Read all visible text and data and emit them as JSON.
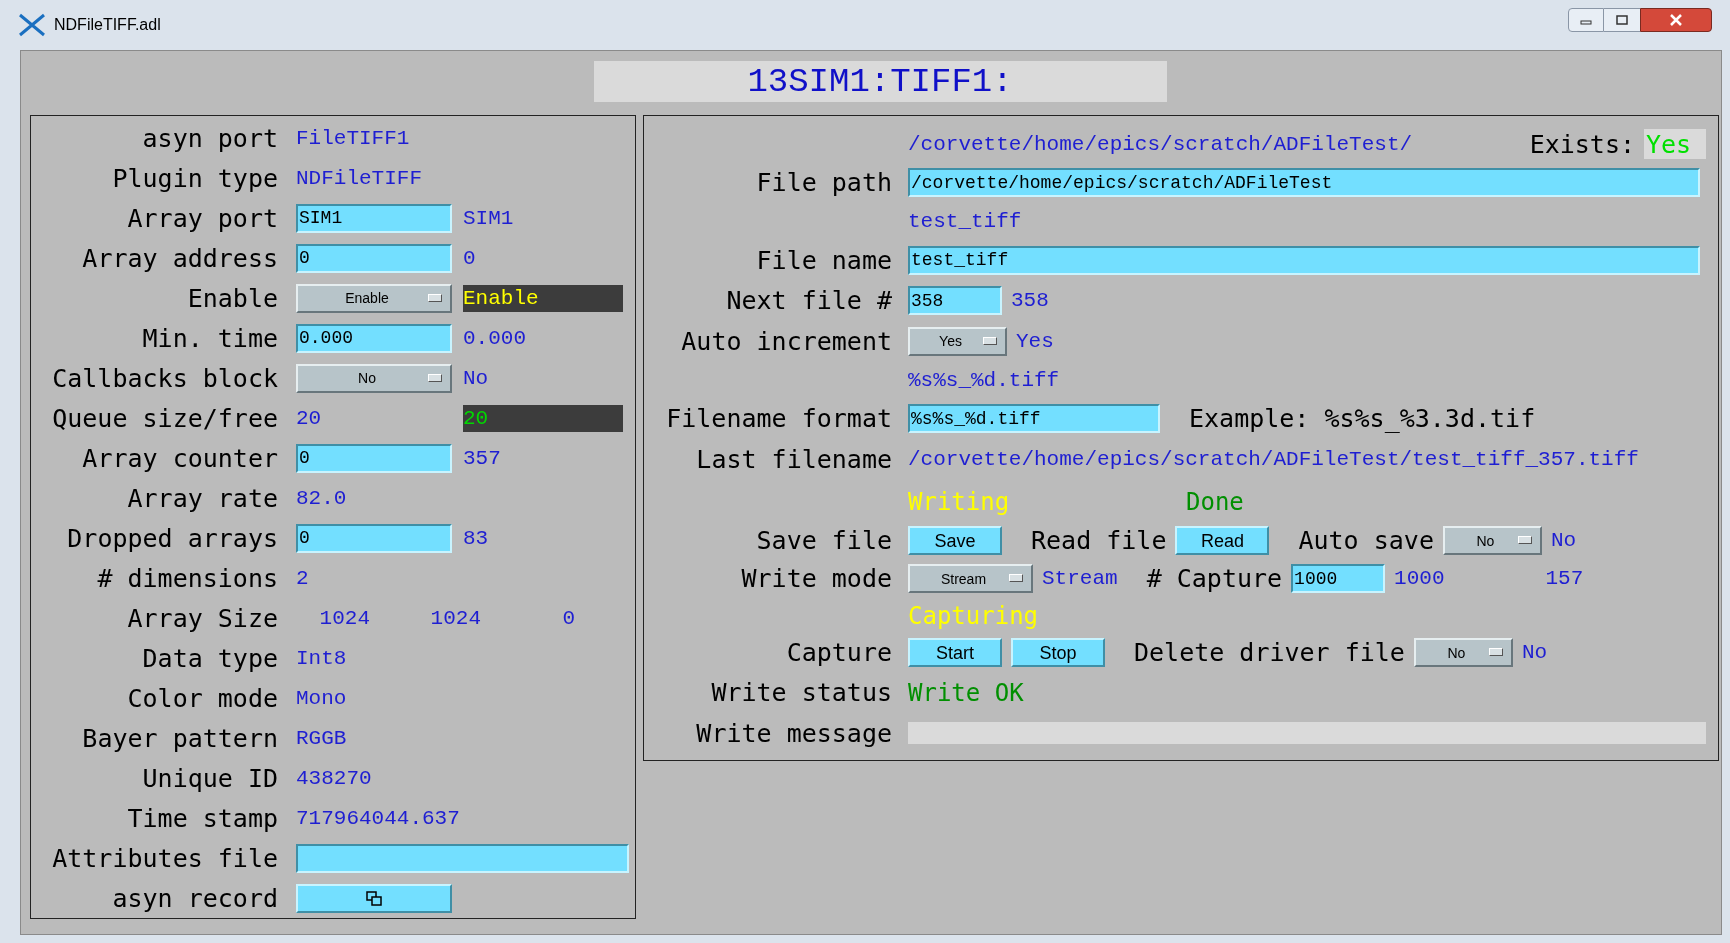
{
  "window": {
    "title": "NDFileTIFF.adl"
  },
  "header": "13SIM1:TIFF1:",
  "left_panel": {
    "rows": [
      {
        "label": "asyn port",
        "kind": "monitor",
        "value": "FileTIFF1"
      },
      {
        "label": "Plugin type",
        "kind": "monitor",
        "value": "NDFileTIFF"
      },
      {
        "label": "Array port",
        "kind": "entry",
        "value": "SIM1",
        "readback": {
          "text": "SIM1",
          "boxed": false
        }
      },
      {
        "label": "Array address",
        "kind": "entry",
        "value": "0",
        "readback": {
          "text": "0",
          "boxed": false
        }
      },
      {
        "label": "Enable",
        "kind": "menu",
        "value": "Enable",
        "readback": {
          "text": "Enable",
          "boxed": true,
          "color": "#ffff00"
        }
      },
      {
        "label": "Min. time",
        "kind": "entry",
        "value": "0.000",
        "readback": {
          "text": "0.000",
          "boxed": false
        }
      },
      {
        "label": "Callbacks block",
        "kind": "menu",
        "value": "No",
        "readback": {
          "text": "No",
          "boxed": false
        }
      },
      {
        "label": "Queue size/free",
        "kind": "monitor_pair",
        "value": "20",
        "readback": {
          "text": "20",
          "boxed": true,
          "color": "#00d800"
        }
      },
      {
        "label": "Array counter",
        "kind": "entry",
        "value": "0",
        "readback": {
          "text": "357",
          "boxed": false
        }
      },
      {
        "label": "Array rate",
        "kind": "monitor",
        "value": "82.0"
      },
      {
        "label": "Dropped arrays",
        "kind": "entry",
        "value": "0",
        "readback": {
          "text": "83",
          "boxed": false
        }
      },
      {
        "label": "# dimensions",
        "kind": "monitor",
        "value": "2"
      },
      {
        "label": "Array Size",
        "kind": "array",
        "values": [
          "1024",
          "1024",
          "0"
        ]
      },
      {
        "label": "Data type",
        "kind": "monitor",
        "value": "Int8"
      },
      {
        "label": "Color mode",
        "kind": "monitor",
        "value": "Mono"
      },
      {
        "label": "Bayer pattern",
        "kind": "monitor",
        "value": "RGGB"
      },
      {
        "label": "Unique ID",
        "kind": "monitor",
        "value": "438270"
      },
      {
        "label": "Time stamp",
        "kind": "monitor",
        "value": "717964044.637"
      },
      {
        "label": "Attributes file",
        "kind": "wide_entry"
      },
      {
        "label": "asyn record",
        "kind": "related_display"
      }
    ]
  },
  "right_panel": {
    "rows": [
      {
        "items": [
          {
            "kind": "readback",
            "text": "/corvette/home/epics/scratch/ADFileTest/"
          },
          {
            "kind": "right_label",
            "text": "Exists:"
          },
          {
            "kind": "indicator",
            "text": "Yes",
            "color": "#00e000"
          }
        ]
      },
      {
        "label": "File path",
        "items": [
          {
            "kind": "field_wide",
            "text": "/corvette/home/epics/scratch/ADFileTest"
          }
        ]
      },
      {
        "items": [
          {
            "kind": "readback",
            "text": "test_tiff"
          }
        ]
      },
      {
        "label": "File name",
        "items": [
          {
            "kind": "field_wide",
            "text": "test_tiff"
          }
        ]
      },
      {
        "label": "Next file #",
        "items": [
          {
            "kind": "field_short",
            "text": "358"
          },
          {
            "kind": "readback",
            "text": "358"
          }
        ]
      },
      {
        "label": "Auto increment",
        "items": [
          {
            "kind": "menu",
            "text": "Yes"
          },
          {
            "kind": "readback",
            "text": "Yes"
          }
        ]
      },
      {
        "items": [
          {
            "kind": "readback",
            "text": "%s%s_%d.tiff"
          }
        ]
      },
      {
        "label": "Filename format",
        "items": [
          {
            "kind": "field_medium",
            "text": "%s%s_%d.tiff"
          },
          {
            "kind": "text",
            "text": "Example: %s%s_%3.3d.tif"
          }
        ]
      },
      {
        "label": "Last filename",
        "items": [
          {
            "kind": "readback",
            "text": "/corvette/home/epics/scratch/ADFileTest/test_tiff_357.tiff"
          }
        ]
      },
      {
        "items": [
          {
            "kind": "status",
            "text": "Writing",
            "color": "#ffff00"
          },
          {
            "kind": "status",
            "text": "Done",
            "color": "#008f00"
          }
        ]
      },
      {
        "label": "Save file",
        "items": [
          {
            "kind": "button",
            "text": "Save"
          },
          {
            "kind": "text",
            "text": "Read file"
          },
          {
            "kind": "button",
            "text": "Read"
          },
          {
            "kind": "text",
            "text": "Auto save"
          },
          {
            "kind": "menu",
            "text": "No"
          },
          {
            "kind": "readback",
            "text": "No"
          }
        ]
      },
      {
        "label": "Write mode",
        "items": [
          {
            "kind": "menu_wide",
            "text": "Stream"
          },
          {
            "kind": "readback",
            "text": "Stream"
          },
          {
            "kind": "text",
            "text": "# Capture"
          },
          {
            "kind": "field_short",
            "text": "1000"
          },
          {
            "kind": "readback",
            "text": "1000"
          },
          {
            "kind": "counter",
            "text": "157"
          }
        ]
      },
      {
        "items": [
          {
            "kind": "status",
            "text": "Capturing",
            "color": "#ffff00"
          }
        ]
      },
      {
        "label": "Capture",
        "items": [
          {
            "kind": "button",
            "text": "Start"
          },
          {
            "kind": "button",
            "text": "Stop"
          },
          {
            "kind": "text",
            "text": "Delete driver file"
          },
          {
            "kind": "menu",
            "text": "No"
          },
          {
            "kind": "readback",
            "text": "No"
          }
        ]
      },
      {
        "label": "Write status",
        "items": [
          {
            "kind": "status",
            "text": "Write OK",
            "color": "#008f00"
          }
        ]
      },
      {
        "label": "Write message",
        "items": [
          {
            "kind": "message_bar"
          }
        ]
      }
    ]
  }
}
